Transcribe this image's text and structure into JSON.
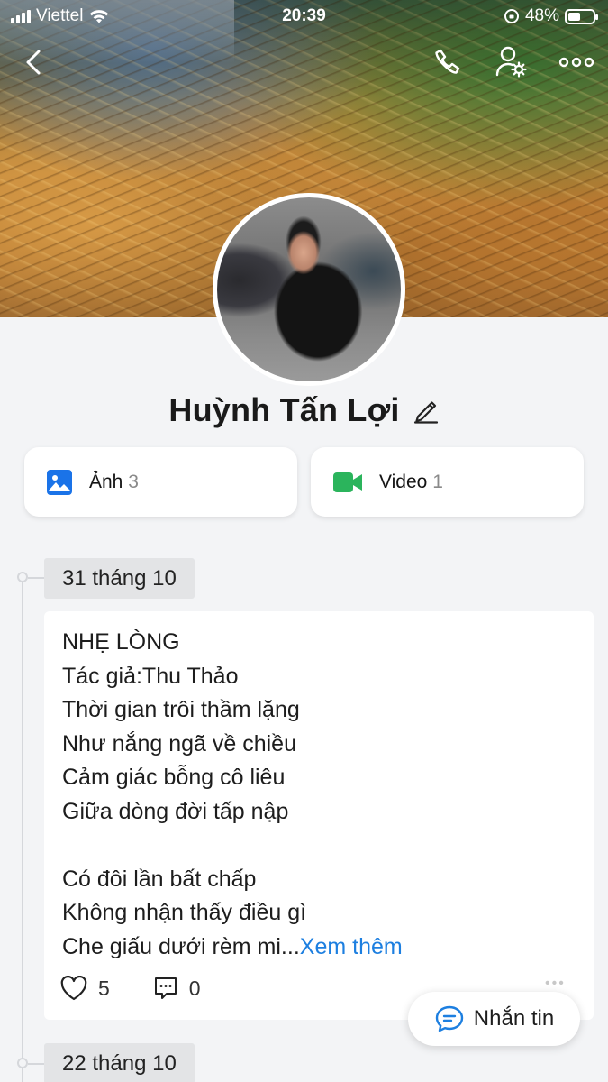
{
  "status_bar": {
    "carrier": "Viettel",
    "time": "20:39",
    "battery": "48%"
  },
  "profile": {
    "name": "Huỳnh Tấn Lợi"
  },
  "media": {
    "photos": {
      "label": "Ảnh",
      "count": "3",
      "icon": "image-icon",
      "color": "#1a73e8"
    },
    "videos": {
      "label": "Video",
      "count": "1",
      "icon": "video-camera-icon",
      "color": "#2bb45c"
    }
  },
  "timeline": [
    {
      "date": "31 tháng 10",
      "lines": [
        "NHẸ LÒNG",
        "Tác giả:Thu Thảo",
        "Thời gian trôi thầm lặng",
        "Như nắng ngã về chiều",
        "Cảm giác bỗng cô liêu",
        "Giữa dòng đời tấp nập",
        "",
        "Có đôi lần bất chấp",
        "Không nhận thấy điều gì",
        "Che giấu dưới rèm mi..."
      ],
      "see_more": "Xem thêm",
      "likes": "5",
      "comments": "0"
    },
    {
      "date": "22 tháng 10"
    }
  ],
  "message_button": {
    "label": "Nhắn tin"
  },
  "colors": {
    "accent": "#1d7fe0",
    "background": "#f3f4f6"
  }
}
